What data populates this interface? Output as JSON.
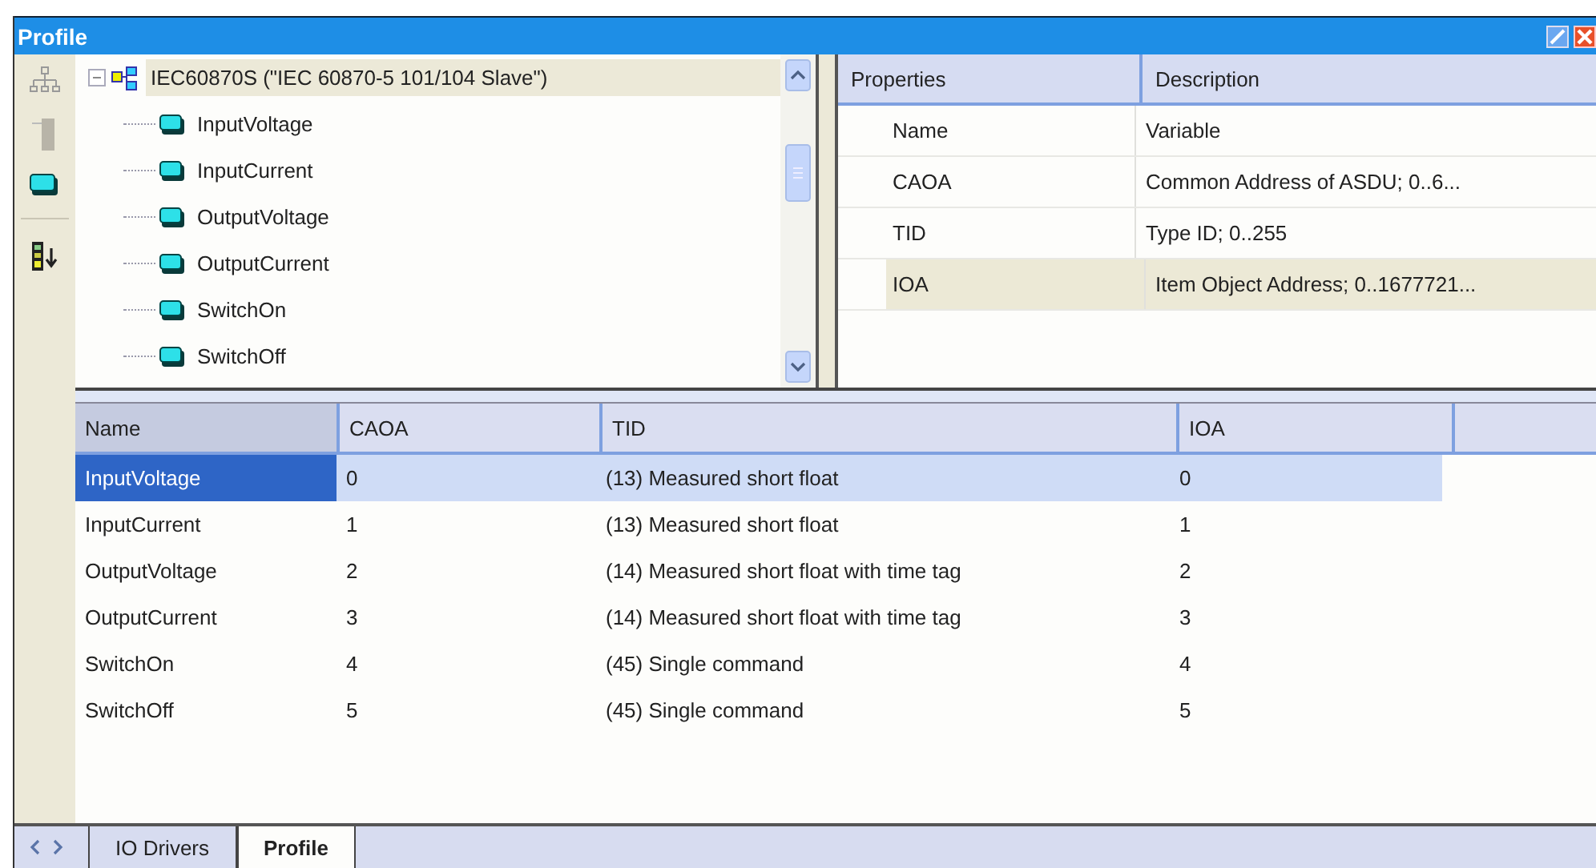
{
  "window": {
    "title": "Profile"
  },
  "tree": {
    "label": "IEC60870S (\"IEC 60870-5 101/104 Slave\")",
    "expanded": true,
    "selected": true,
    "children": [
      {
        "label": "InputVoltage",
        "selected": false
      },
      {
        "label": "InputCurrent",
        "selected": false
      },
      {
        "label": "OutputVoltage",
        "selected": false
      },
      {
        "label": "OutputCurrent",
        "selected": false
      },
      {
        "label": "SwitchOn",
        "selected": false
      },
      {
        "label": "SwitchOff",
        "selected": false
      }
    ]
  },
  "properties": {
    "columns": [
      "Properties",
      "Description"
    ],
    "rows": [
      {
        "property": "Name",
        "description": "Variable",
        "selected": false
      },
      {
        "property": "CAOA",
        "description": "Common Address of ASDU; 0..6...",
        "selected": false
      },
      {
        "property": "TID",
        "description": "Type ID; 0..255",
        "selected": false
      },
      {
        "property": "IOA",
        "description": "Item Object Address; 0..1677721...",
        "selected": true
      }
    ]
  },
  "table": {
    "columns": [
      "Name",
      "CAOA",
      "TID",
      "IOA"
    ],
    "rows": [
      {
        "cells": [
          "InputVoltage",
          "0",
          "(13) Measured short float",
          "0"
        ],
        "selected": true
      },
      {
        "cells": [
          "InputCurrent",
          "1",
          "(13) Measured short float",
          "1"
        ],
        "selected": false
      },
      {
        "cells": [
          "OutputVoltage",
          "2",
          "(14) Measured short float with time tag",
          "2"
        ],
        "selected": false
      },
      {
        "cells": [
          "OutputCurrent",
          "3",
          "(14) Measured short float with time tag",
          "3"
        ],
        "selected": false
      },
      {
        "cells": [
          "SwitchOn",
          "4",
          "(45) Single command",
          "4"
        ],
        "selected": false
      },
      {
        "cells": [
          "SwitchOff",
          "5",
          "(45) Single command",
          "5"
        ],
        "selected": false
      }
    ]
  },
  "tabs": [
    {
      "label": "IO Drivers",
      "selected": false
    },
    {
      "label": "Profile",
      "selected": true
    }
  ]
}
